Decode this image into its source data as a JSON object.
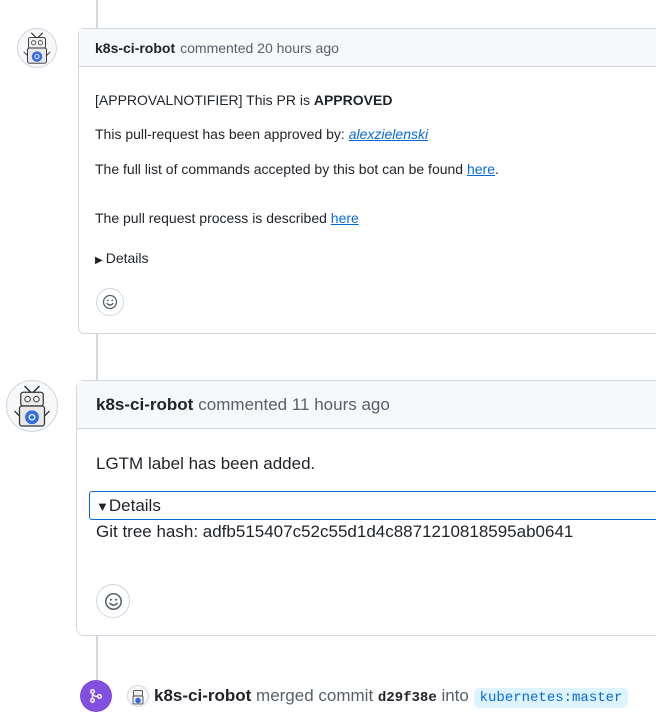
{
  "comment1": {
    "author": "k8s-ci-robot",
    "meta": "commented 20 hours ago",
    "body": {
      "approval_prefix": "[APPROVALNOTIFIER] This PR is ",
      "approval_status": "APPROVED",
      "approved_by_text": "This pull-request has been approved by: ",
      "approver": "alexzielenski",
      "commands_text": "The full list of commands accepted by this bot can be found ",
      "commands_link": "here",
      "commands_suffix": ".",
      "process_text": "The pull request process is described ",
      "process_link": "here",
      "details_label": "Details"
    }
  },
  "comment2": {
    "author": "k8s-ci-robot",
    "meta": "commented 11 hours ago",
    "body": {
      "message": "LGTM label has been added.",
      "details_label": "Details",
      "tree_hash": "Git tree hash: adfb515407c52c55d1d4c8871210818595ab0641"
    }
  },
  "merge_event": {
    "author": "k8s-ci-robot",
    "action": "merged commit",
    "commit": "d29f38e",
    "into": "into",
    "target": "kubernetes:master"
  },
  "icons": {
    "reaction": "smiley-icon",
    "merge": "git-merge-icon",
    "avatar": "robot-avatar"
  },
  "colors": {
    "link": "#0969da",
    "merge_badge": "#8250df",
    "border": "#d0d7de",
    "header_bg": "#f6f8fa"
  }
}
